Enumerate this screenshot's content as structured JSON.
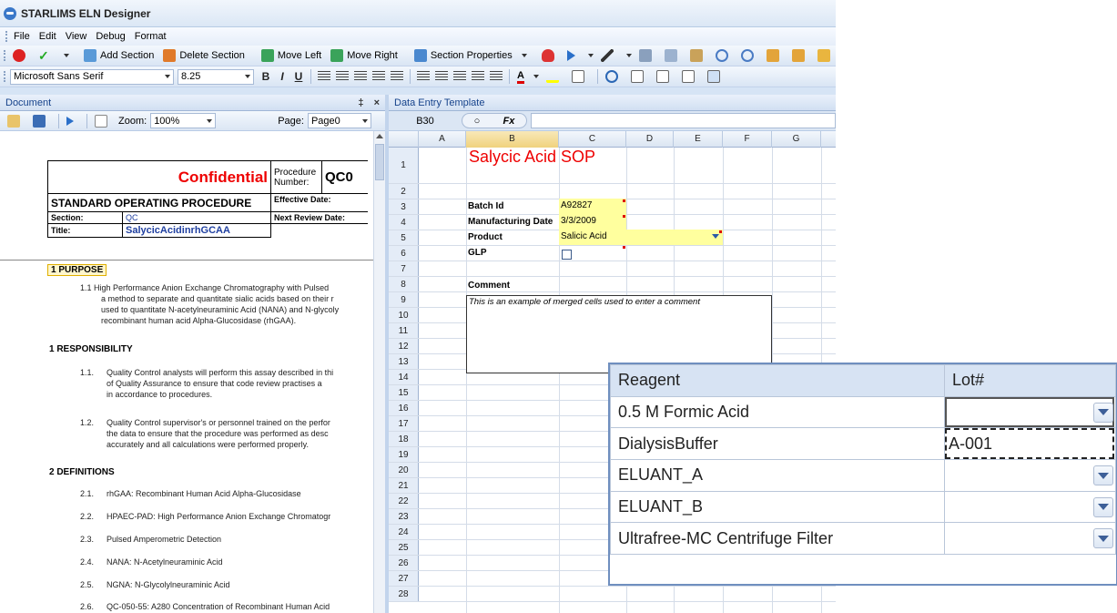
{
  "window": {
    "title": "STARLIMS ELN Designer"
  },
  "menu": [
    "File",
    "Edit",
    "View",
    "Debug",
    "Format"
  ],
  "toolbar": {
    "add_section": "Add Section",
    "delete_section": "Delete Section",
    "move_left": "Move Left",
    "move_right": "Move Right",
    "section_properties": "Section Properties"
  },
  "format_bar": {
    "font": "Microsoft Sans Serif",
    "size": "8.25",
    "bold": "B",
    "italic": "I",
    "underline": "U"
  },
  "document": {
    "panel_title": "Document",
    "pin": "‡",
    "close": "×",
    "zoom_label": "Zoom:",
    "zoom_value": "100%",
    "page_label": "Page:",
    "page_value": "Page0",
    "header": {
      "confidential": "Confidential",
      "procedure_number_label": "Procedure Number:",
      "procedure_number_value": "QC0",
      "sop": "STANDARD OPERATING PROCEDURE",
      "effective_date": "Effective Date:",
      "section_label": "Section:",
      "section_value": "QC",
      "next_review": "Next  Review Date:",
      "title_label": "Title:",
      "title_value": "SalycicAcidinrhGCAA"
    },
    "purpose_heading": "1   PURPOSE",
    "purpose_lines": [
      "1.1  High Performance Anion Exchange Chromatography with Pulsed",
      "a method to separate and quantitate sialic acids based on their r",
      "used to quantitate N-acetylneuraminic Acid (NANA) and N-glycoly",
      "recombinant human acid Alpha-Glucosidase (rhGAA)."
    ],
    "responsibility_heading": "1   RESPONSIBILITY",
    "resp_11_num": "1.1.",
    "resp_11": [
      "Quality Control analysts will perform this assay described in thi",
      "of Quality Assurance  to ensure that code review practises a",
      "in accordance to procedures."
    ],
    "resp_12_num": "1.2.",
    "resp_12": [
      "Quality Control supervisor's or personnel trained on the perfor",
      "the data to ensure that the procedure was performed as desc",
      "accurately and all calculations were performed properly."
    ],
    "definitions_heading": "2   DEFINITIONS",
    "definitions": [
      {
        "num": "2.1.",
        "text": "rhGAA: Recombinant Human Acid Alpha-Glucosidase"
      },
      {
        "num": "2.2.",
        "text": "HPAEC-PAD: High Performance Anion Exchange Chromatogr"
      },
      {
        "num": "2.3.",
        "text": "Pulsed Amperometric Detection"
      },
      {
        "num": "2.4.",
        "text": "NANA: N-Acetylneuraminic  Acid"
      },
      {
        "num": "2.5.",
        "text": "NGNA: N-Glycolylneuraminic  Acid"
      },
      {
        "num": "2.6.",
        "text": "QC-050-55: A280 Concentration  of Recombinant Human Acid"
      }
    ]
  },
  "sheet": {
    "panel_title": "Data Entry Template",
    "cell_ref": "B30",
    "fx": "Fx",
    "columns": [
      "A",
      "B",
      "C",
      "D",
      "E",
      "F",
      "G"
    ],
    "rows": [
      "1",
      "2",
      "3",
      "4",
      "5",
      "6",
      "7",
      "8",
      "9",
      "10",
      "11",
      "12",
      "13",
      "14",
      "15",
      "16",
      "17",
      "18",
      "19",
      "20",
      "21",
      "22",
      "23",
      "24",
      "25",
      "26",
      "27",
      "28"
    ],
    "heading": "Salycic Acid  SOP",
    "batch_label": "Batch Id",
    "batch_value": "A92827",
    "mfg_label": "Manufacturing Date",
    "mfg_value": "3/3/2009",
    "product_label": "Product",
    "product_value": "Salicic Acid",
    "glp_label": "GLP",
    "comment_label": "Comment",
    "comment_value": "This is an example of merged cells used to enter a comment"
  },
  "zoom_table": {
    "headers": [
      "Reagent",
      "Lot#"
    ],
    "rows": [
      {
        "reagent": "0.5 M Formic Acid",
        "lot": ""
      },
      {
        "reagent": "DialysisBuffer",
        "lot": "A-001"
      },
      {
        "reagent": "ELUANT_A",
        "lot": ""
      },
      {
        "reagent": "ELUANT_B",
        "lot": ""
      },
      {
        "reagent": "Ultrafree-MC Centrifuge Filter",
        "lot": ""
      }
    ]
  },
  "colors": {
    "accent": "#e00000",
    "highlight": "#ffff9e",
    "chrome": "#d6e4f5"
  }
}
